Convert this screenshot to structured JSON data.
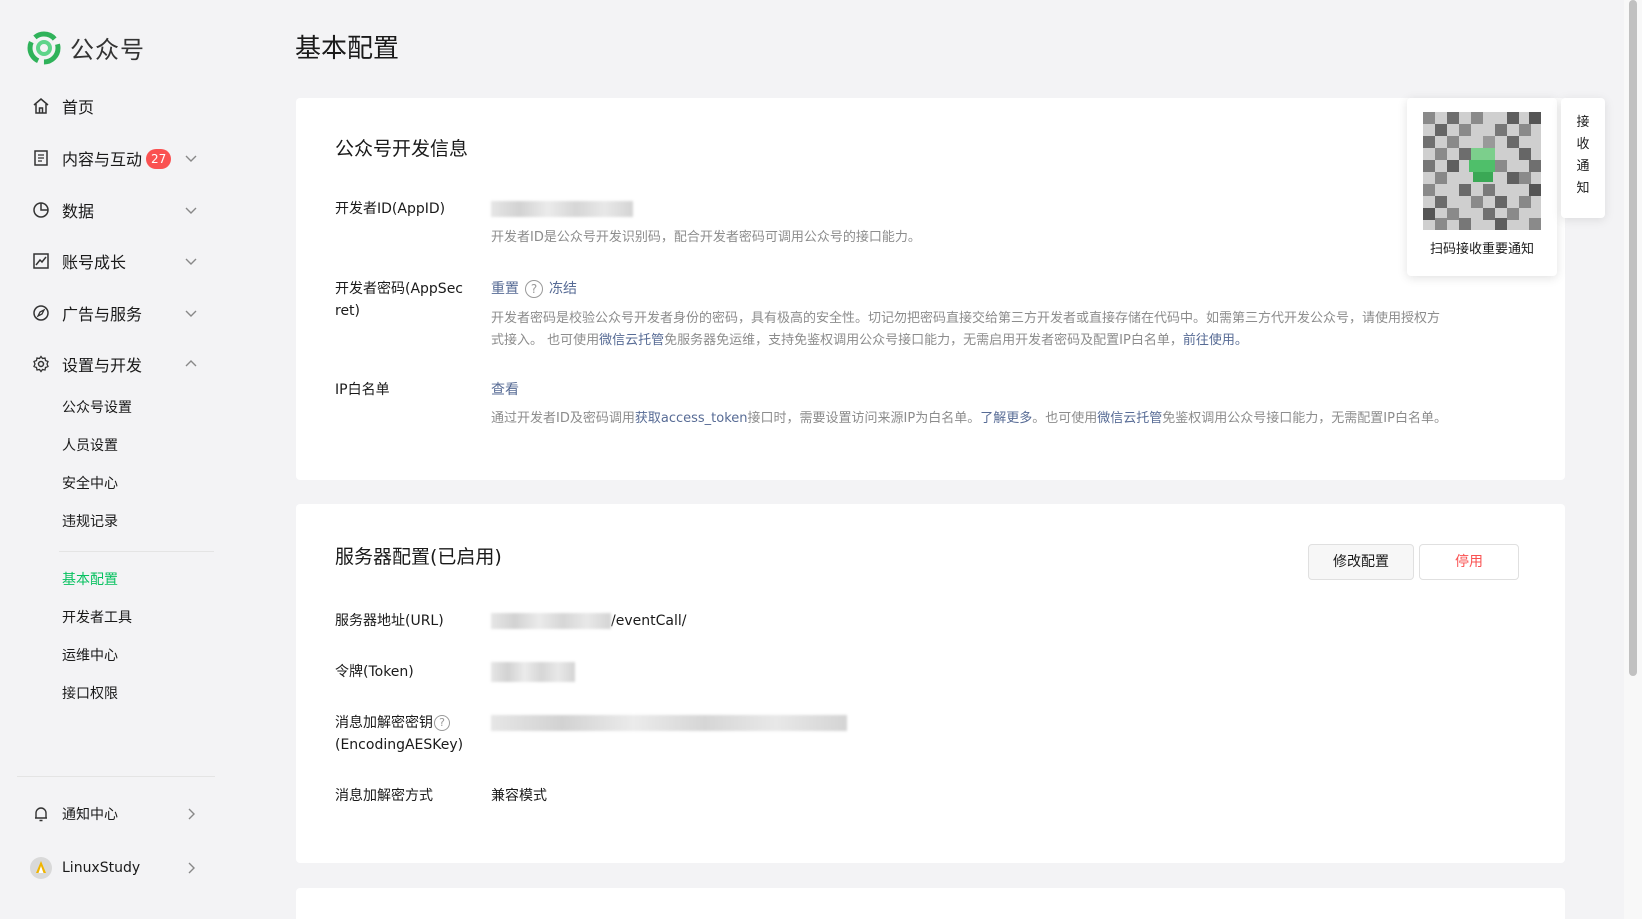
{
  "app": {
    "name": "公众号"
  },
  "page": {
    "title": "基本配置"
  },
  "sidebar": {
    "nav": [
      {
        "label": "首页",
        "icon": "home-icon"
      },
      {
        "label": "内容与互动",
        "icon": "document-icon",
        "badge": "27"
      },
      {
        "label": "数据",
        "icon": "pie-chart-icon"
      },
      {
        "label": "账号成长",
        "icon": "growth-chart-icon"
      },
      {
        "label": "广告与服务",
        "icon": "compass-icon"
      },
      {
        "label": "设置与开发",
        "icon": "gear-icon"
      }
    ],
    "sub_items": [
      "公众号设置",
      "人员设置",
      "安全中心",
      "违规记录",
      "基本配置",
      "开发者工具",
      "运维中心",
      "接口权限"
    ],
    "active_item": "基本配置",
    "notify_center": "通知中心",
    "account": "LinuxStudy"
  },
  "dev_info": {
    "title": "公众号开发信息",
    "appid_label": "开发者ID(AppID)",
    "appid_desc": "开发者ID是公众号开发识别码，配合开发者密码可调用公众号的接口能力。",
    "secret_label": "开发者密码(AppSecret)",
    "secret_reset": "重置",
    "secret_freeze": "冻结",
    "secret_desc_1": "开发者密码是校验公众号开发者身份的密码，具有极高的安全性。切记勿把密码直接交给第三方开发者或直接存储在代码中。如需第三方代开发公众号，请使用授权方",
    "secret_desc_2a": "式接入。 也可使用",
    "secret_desc_2_link1": "微信云托管",
    "secret_desc_2b": "免服务器免运维，支持免鉴权调用公众号接口能力，无需启用开发者密码及配置IP白名单，",
    "secret_desc_2_link2": "前往使用。",
    "ip_label": "IP白名单",
    "ip_view": "查看",
    "ip_desc_a": "通过开发者ID及密码调用",
    "ip_desc_link1": "获取access_token",
    "ip_desc_b": "接口时，需要设置访问来源IP为白名单。",
    "ip_desc_link2": "了解更多",
    "ip_desc_c": "。也可使用",
    "ip_desc_link3": "微信云托管",
    "ip_desc_d": "免鉴权调用公众号接口能力，无需配置IP白名单。"
  },
  "server_config": {
    "title": "服务器配置(已启用)",
    "edit_button": "修改配置",
    "stop_button": "停用",
    "url_label": "服务器地址(URL)",
    "url_suffix": "/eventCall/",
    "token_label": "令牌(Token)",
    "aeskey_label_1": "消息加解密密钥",
    "aeskey_label_2": "(EncodingAESKey)",
    "mode_label": "消息加解密方式",
    "mode_value": "兼容模式"
  },
  "qr_popup": {
    "caption": "扫码接收重要通知",
    "tab_text": [
      "接",
      "收",
      "通",
      "知"
    ]
  },
  "colors": {
    "brand_green": "#07c160",
    "link": "#576b95",
    "danger": "#fa5151",
    "badge": "#fa5151"
  }
}
